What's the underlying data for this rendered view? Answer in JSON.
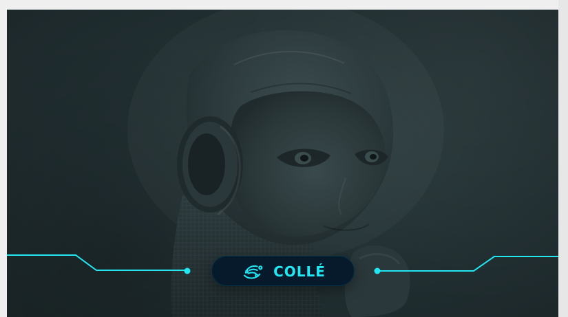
{
  "hero": {
    "logo": {
      "text": "COLLÉ"
    }
  },
  "colors": {
    "accent": "#22e6f2",
    "pill_bg": "#061a2b",
    "hero_bg": "#223033",
    "page_bg": "#efefef"
  },
  "icons": {
    "logo_icon": "colle-logo-icon"
  }
}
